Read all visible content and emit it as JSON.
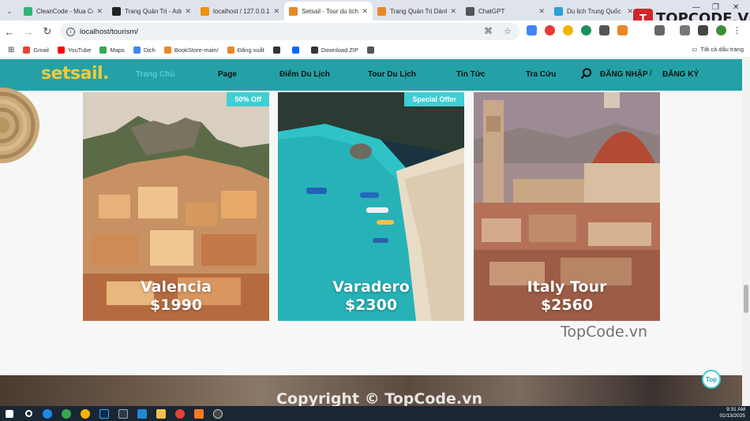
{
  "browser": {
    "tabs": [
      {
        "label": "CleanCode - Mua Code",
        "color": "#2bb673",
        "active": false
      },
      {
        "label": "Trang Quản Trị - Admin",
        "color": "#222222",
        "active": false
      },
      {
        "label": "localhost / 127.0.0.1 /",
        "color": "#f29111",
        "active": false
      },
      {
        "label": "Setsail - Tour du lịch",
        "color": "#e8862a",
        "active": true
      },
      {
        "label": "Trang Quản Trị Dành",
        "color": "#e8862a",
        "active": false
      },
      {
        "label": "ChatGPT",
        "color": "#555555",
        "active": false
      },
      {
        "label": "Du lịch Trung Quốc",
        "color": "#2a9fd8",
        "active": false
      }
    ],
    "url": "localhost/tourism/",
    "bookmarks": [
      {
        "label": "Gmail",
        "color": "#ea4335"
      },
      {
        "label": "YouTube",
        "color": "#ff0000"
      },
      {
        "label": "Maps",
        "color": "#34a853"
      },
      {
        "label": "Dịch",
        "color": "#4285f4"
      },
      {
        "label": "BookStore-main/",
        "color": "#e8862a"
      },
      {
        "label": "Đăng xuất",
        "color": "#e8862a"
      },
      {
        "label": "",
        "color": "#333333"
      },
      {
        "label": "",
        "color": "#0866ff"
      },
      {
        "label": "Download ZIP",
        "color": "#333333"
      },
      {
        "label": "",
        "color": "#555555"
      }
    ],
    "bookmarks_folder": "Tất cả dấu trang"
  },
  "brand": {
    "mark": "T",
    "text": "TOPCODE.VN"
  },
  "site": {
    "logo": "setsail.",
    "nav": [
      {
        "label": "Trang Chủ",
        "active": true
      },
      {
        "label": "Page",
        "active": false
      },
      {
        "label": "Điểm Du Lịch",
        "active": false
      },
      {
        "label": "Tour Du Lịch",
        "active": false
      },
      {
        "label": "Tin Tức",
        "active": false
      },
      {
        "label": "Tra Cứu",
        "active": false
      }
    ],
    "login": "ĐĂNG NHẬP",
    "separator": "/",
    "register": "ĐĂNG KÝ",
    "search_icon": "search-icon"
  },
  "tours": [
    {
      "name": "Valencia",
      "price": "$1990",
      "badge": "50% Off"
    },
    {
      "name": "Varadero",
      "price": "$2300",
      "badge": "Special Offer"
    },
    {
      "name": "Italy Tour",
      "price": "$2560",
      "badge": ""
    }
  ],
  "watermark": "TopCode.vn",
  "copyright": "Copyright © TopCode.vn",
  "top_button": "Top",
  "taskbar": {
    "time": "9:31 AM",
    "date": "01/13/2025"
  }
}
